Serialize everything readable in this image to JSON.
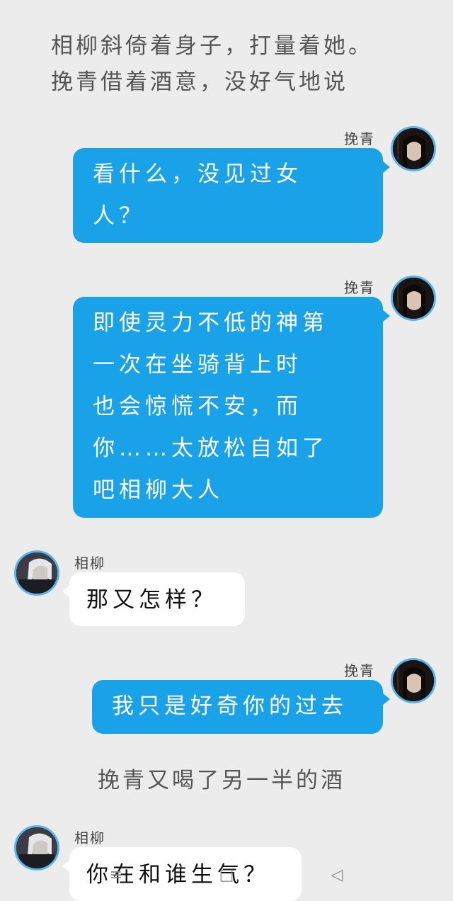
{
  "narration": {
    "line1": "相柳斜倚着身子，打量着她。",
    "line2": "挽青借着酒意，没好气地说",
    "line3": "挽青又喝了另一半的酒"
  },
  "messages": [
    {
      "sender": "挽青",
      "side": "right",
      "lines": [
        "看什么，没见过女",
        "人？"
      ]
    },
    {
      "sender": "挽青",
      "side": "right",
      "lines": [
        "即使灵力不低的神第",
        "一次在坐骑背上时",
        "也会惊慌不安，而",
        "你……太放松自如了",
        "吧相柳大人"
      ]
    },
    {
      "sender": "相柳",
      "side": "left",
      "lines": [
        "那又怎样？"
      ]
    },
    {
      "sender": "挽青",
      "side": "right",
      "lines": [
        "我只是好奇你的过去"
      ]
    },
    {
      "sender": "相柳",
      "side": "left",
      "lines": [
        "你在和谁生气？"
      ]
    }
  ],
  "navbar": {
    "menu_icon": "menu-lines-icon",
    "home_icon": "home-square-icon",
    "back_icon": "back-triangle-icon",
    "back_glyph": "◁",
    "menu_glyph": "≡",
    "home_glyph": "□"
  },
  "colors": {
    "background": "#ececec",
    "right_bubble": "#1aa2e8",
    "left_bubble": "#ffffff",
    "avatar_ring": "#5bb3ee"
  }
}
